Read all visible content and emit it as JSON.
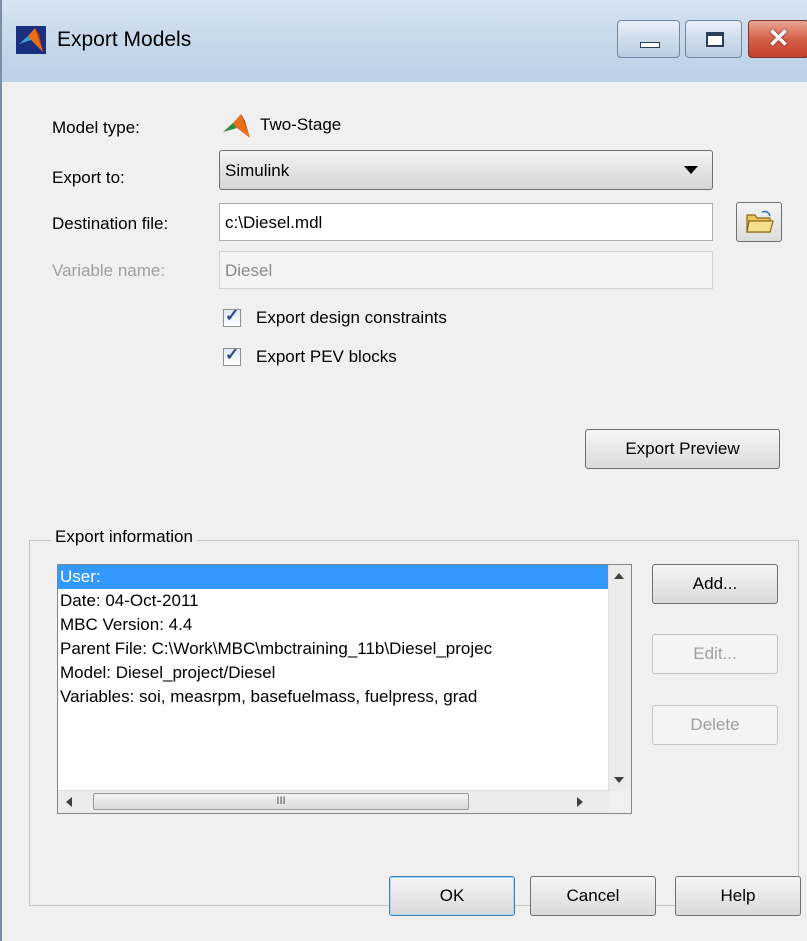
{
  "window": {
    "title": "Export Models",
    "colors": {
      "titlebar": "#c4d6ea",
      "close": "#c2402b",
      "selection": "#3399ff"
    }
  },
  "form": {
    "model_type_label": "Model type:",
    "model_type_value": "Two-Stage",
    "export_to_label": "Export to:",
    "export_to_value": "Simulink",
    "destination_label": "Destination file:",
    "destination_value": "c:\\Diesel.mdl",
    "variable_label": "Variable name:",
    "variable_value": "Diesel",
    "check_constraints_label": "Export design constraints",
    "check_constraints_checked": true,
    "check_pev_label": "Export PEV blocks",
    "check_pev_checked": true,
    "export_preview_label": "Export Preview"
  },
  "export_info": {
    "title": "Export information",
    "items": [
      "User:",
      "Date: 04-Oct-2011",
      "MBC Version: 4.4",
      "Parent File: C:\\Work\\MBC\\mbctraining_11b\\Diesel_projec",
      "Model: Diesel_project/Diesel",
      "Variables: soi, measrpm, basefuelmass, fuelpress, grad"
    ],
    "selected_index": 0,
    "add_label": "Add...",
    "edit_label": "Edit...",
    "delete_label": "Delete",
    "hscroll_grip": "III"
  },
  "footer": {
    "ok_label": "OK",
    "cancel_label": "Cancel",
    "help_label": "Help"
  }
}
